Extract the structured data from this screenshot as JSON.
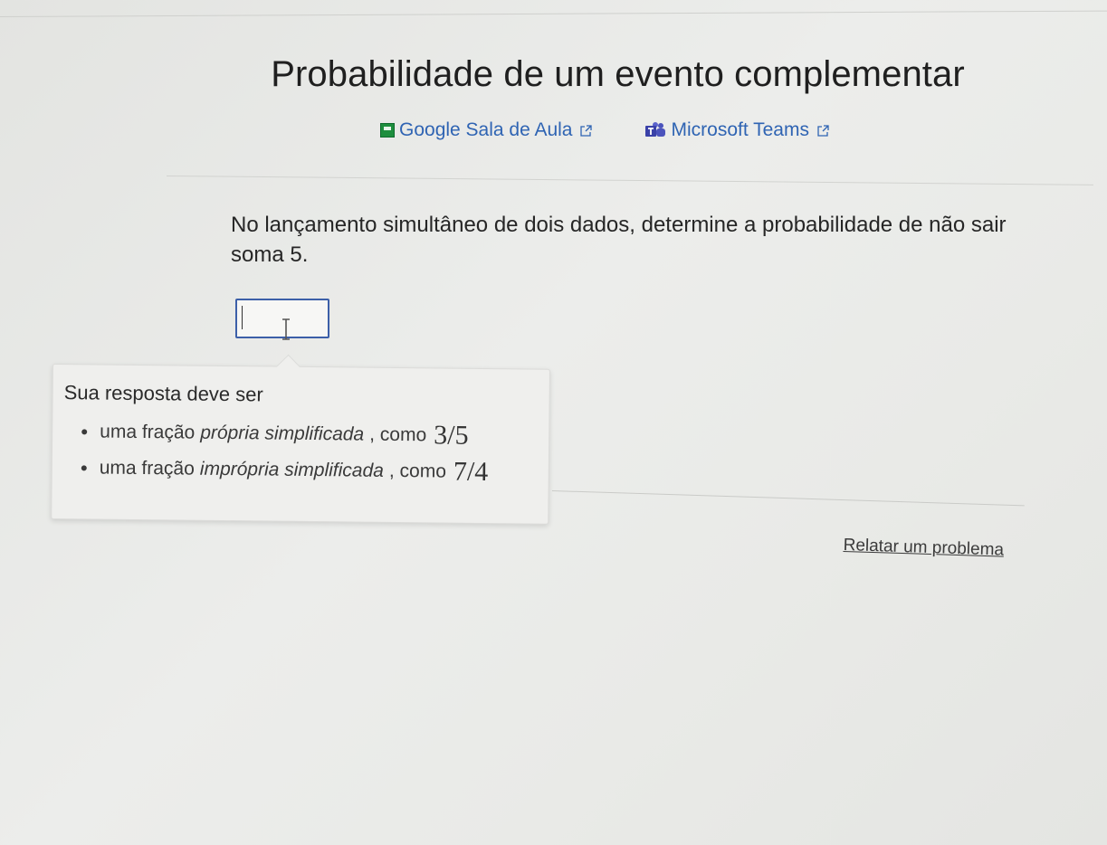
{
  "page": {
    "title": "Probabilidade de um evento complementar"
  },
  "share": {
    "classroom": {
      "label": "Google Sala de Aula",
      "icon": "google-classroom-icon",
      "external_icon": "external-link-icon",
      "color": "#2f64b3"
    },
    "teams": {
      "label": "Microsoft Teams",
      "icon": "microsoft-teams-icon",
      "external_icon": "external-link-icon",
      "color": "#2f64b3"
    }
  },
  "question": {
    "text": "No lançamento simultâneo de dois dados, determine a probabilidade de não sair soma 5."
  },
  "answer": {
    "value": "",
    "border_color": "#3c5fa8"
  },
  "tooltip": {
    "title": "Sua resposta deve ser",
    "items": [
      {
        "prefix": "uma fração",
        "emphasis": "própria simplificada",
        "suffix": ", como",
        "example": "3/5"
      },
      {
        "prefix": "uma fração",
        "emphasis": "imprópria simplificada",
        "suffix": ", como",
        "example": "7/4"
      }
    ]
  },
  "footer": {
    "report_label": "Relatar um problema"
  }
}
